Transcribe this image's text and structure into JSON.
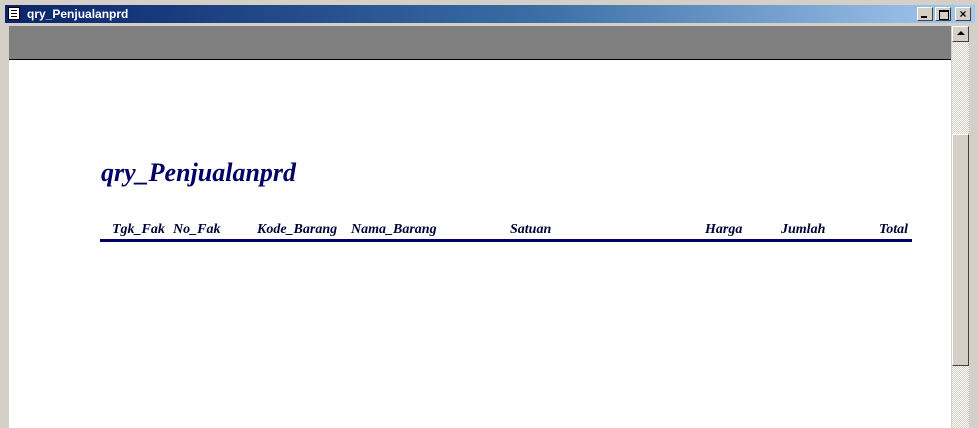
{
  "window": {
    "title": "qry_Penjualanprd",
    "icon": "report-icon",
    "controls": {
      "minimize": "minimize-icon",
      "maximize": "maximize-icon",
      "close_glyph": "×"
    }
  },
  "report": {
    "title": "qry_Penjualanprd",
    "columns": [
      {
        "label": "Tgk_Fak"
      },
      {
        "label": "No_Fak"
      },
      {
        "label": "Kode_Barang"
      },
      {
        "label": "Nama_Barang"
      },
      {
        "label": "Satuan"
      },
      {
        "label": "Harga"
      },
      {
        "label": "Jumlah"
      },
      {
        "label": "Total"
      }
    ]
  },
  "colors": {
    "title_bar_start": "#0a246a",
    "title_bar_end": "#a6caf0",
    "report_text": "#000066",
    "toolbar_strip": "#808080"
  }
}
